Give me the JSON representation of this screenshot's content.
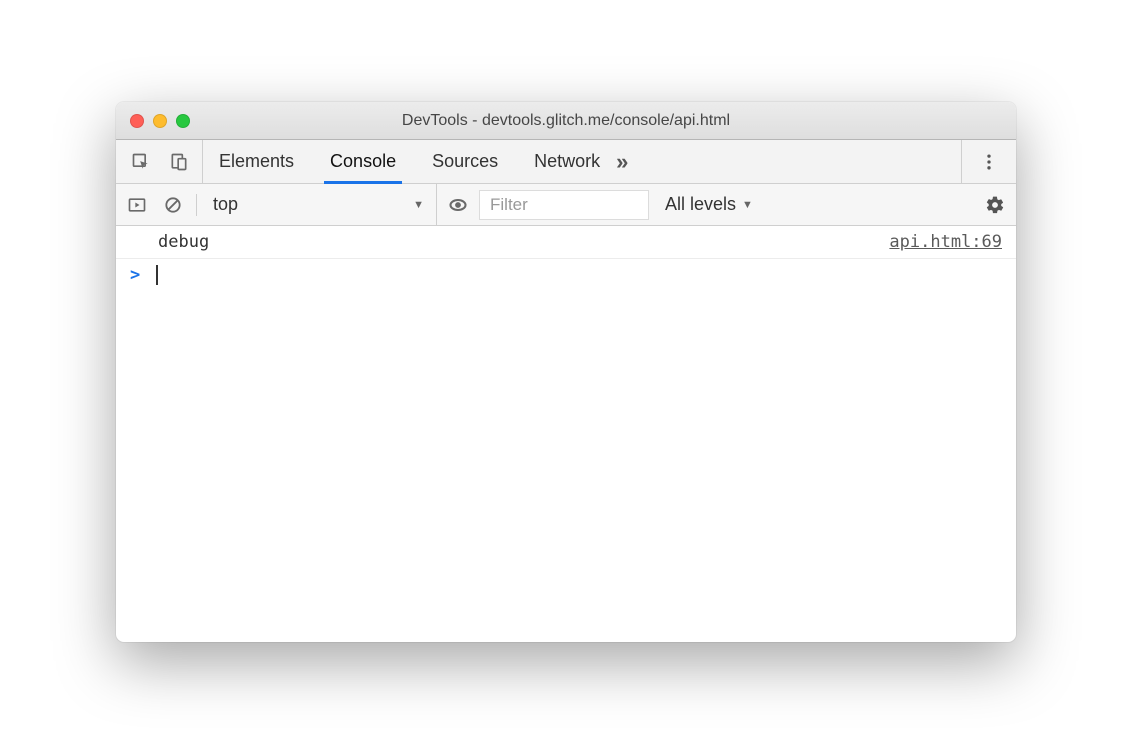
{
  "window": {
    "title": "DevTools - devtools.glitch.me/console/api.html"
  },
  "tabs": {
    "items": [
      "Elements",
      "Console",
      "Sources",
      "Network"
    ],
    "active": "Console"
  },
  "toolbar": {
    "context": "top",
    "filter_placeholder": "Filter",
    "levels_label": "All levels"
  },
  "console": {
    "entries": [
      {
        "text": "debug",
        "source": "api.html:69"
      }
    ],
    "prompt": ">"
  }
}
